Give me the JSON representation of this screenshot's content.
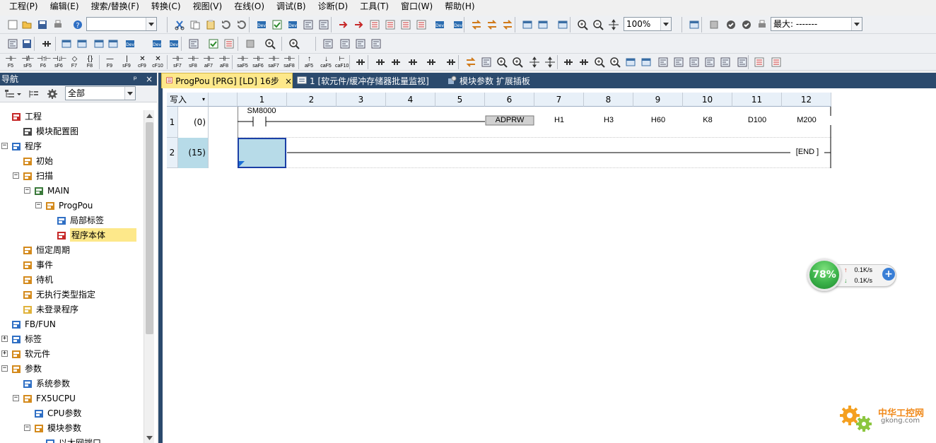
{
  "menu": [
    "工程(P)",
    "编辑(E)",
    "搜索/替换(F)",
    "转换(C)",
    "视图(V)",
    "在线(O)",
    "调试(B)",
    "诊断(D)",
    "工具(T)",
    "窗口(W)",
    "帮助(H)"
  ],
  "toolbar": {
    "zoom": "100%",
    "max_label": "最大: -------"
  },
  "function_keys": [
    {
      "sym": "⊣⊢",
      "label": "F5"
    },
    {
      "sym": "⊣/⊢",
      "label": "sF5"
    },
    {
      "sym": "⊣↑⊢",
      "label": "F6"
    },
    {
      "sym": "⊣↓⊢",
      "label": "sF6"
    },
    {
      "sym": "◇",
      "label": "F7"
    },
    {
      "sym": "{ }",
      "label": "F8"
    },
    {
      "sym": "—",
      "label": "F9"
    },
    {
      "sym": "|",
      "label": "sF9"
    },
    {
      "sym": "✕",
      "label": "cF9"
    },
    {
      "sym": "✕",
      "label": "cF10"
    },
    {
      "sym": "⊣⊢",
      "label": "sF7"
    },
    {
      "sym": "⊣⊢",
      "label": "sF8"
    },
    {
      "sym": "⊣⊢",
      "label": "aF7"
    },
    {
      "sym": "⊣⊢",
      "label": "aF8"
    },
    {
      "sym": "⊣⊢",
      "label": "saF5"
    },
    {
      "sym": "⊣⊢",
      "label": "saF6"
    },
    {
      "sym": "⊣⊢",
      "label": "saF7"
    },
    {
      "sym": "⊣⊢",
      "label": "saF8"
    },
    {
      "sym": "↑",
      "label": "aF5"
    },
    {
      "sym": "↓",
      "label": "caF5"
    },
    {
      "sym": "⊢",
      "label": "caF10"
    }
  ],
  "nav": {
    "title": "导航",
    "pin": "ᵖ",
    "close": "×",
    "filter": "全部",
    "tree": [
      {
        "label": "工程",
        "level": 0,
        "expander": "",
        "icon": "project"
      },
      {
        "label": "模块配置图",
        "level": 1,
        "expander": "",
        "icon": "module-config"
      },
      {
        "label": "程序",
        "level": 0,
        "expander": "−",
        "icon": "program"
      },
      {
        "label": "初始",
        "level": 1,
        "expander": "",
        "icon": "folder"
      },
      {
        "label": "扫描",
        "level": 1,
        "expander": "−",
        "icon": "folder"
      },
      {
        "label": "MAIN",
        "level": 2,
        "expander": "−",
        "icon": "task"
      },
      {
        "label": "ProgPou",
        "level": 3,
        "expander": "−",
        "icon": "pou"
      },
      {
        "label": "局部标签",
        "level": 4,
        "expander": "",
        "icon": "label"
      },
      {
        "label": "程序本体",
        "level": 4,
        "expander": "",
        "icon": "body",
        "selected": true
      },
      {
        "label": "恒定周期",
        "level": 1,
        "expander": "",
        "icon": "folder"
      },
      {
        "label": "事件",
        "level": 1,
        "expander": "",
        "icon": "folder"
      },
      {
        "label": "待机",
        "level": 1,
        "expander": "",
        "icon": "folder"
      },
      {
        "label": "无执行类型指定",
        "level": 1,
        "expander": "",
        "icon": "folder"
      },
      {
        "label": "未登录程序",
        "level": 1,
        "expander": "",
        "icon": "folder-yellow"
      },
      {
        "label": "FB/FUN",
        "level": 0,
        "expander": "",
        "icon": "fb"
      },
      {
        "label": "标签",
        "level": 0,
        "expander": "+",
        "icon": "label"
      },
      {
        "label": "软元件",
        "level": 0,
        "expander": "+",
        "icon": "device"
      },
      {
        "label": "参数",
        "level": 0,
        "expander": "−",
        "icon": "param"
      },
      {
        "label": "系统参数",
        "level": 1,
        "expander": "",
        "icon": "param-sys"
      },
      {
        "label": "FX5UCPU",
        "level": 1,
        "expander": "−",
        "icon": "cpu"
      },
      {
        "label": "CPU参数",
        "level": 2,
        "expander": "",
        "icon": "param-sys"
      },
      {
        "label": "模块参数",
        "level": 2,
        "expander": "−",
        "icon": "param"
      },
      {
        "label": "以太网端口",
        "level": 3,
        "expander": "",
        "icon": "param-sys"
      }
    ]
  },
  "tabs": [
    {
      "label": "ProgPou [PRG] [LD] 16步",
      "active": true,
      "close": "×"
    },
    {
      "label": "1 [软元件/缓冲存储器批量监视]",
      "active": false,
      "close": ""
    },
    {
      "label": "模块参数 扩展插板",
      "active": false,
      "close": ""
    }
  ],
  "ladder": {
    "mode": "写入",
    "columns": [
      "1",
      "2",
      "3",
      "4",
      "5",
      "6",
      "7",
      "8",
      "9",
      "10",
      "11",
      "12"
    ],
    "rung1": {
      "row": "1",
      "step": "(0)",
      "contact": "SM8000",
      "instruction": "ADPRW",
      "operands": [
        "H1",
        "H3",
        "H60",
        "K8",
        "D100",
        "M200"
      ]
    },
    "rung2": {
      "row": "2",
      "step": "(15)",
      "end": "[END ]"
    }
  },
  "netmon": {
    "percent": "78%",
    "up": "0.1K/s",
    "down": "0.1K/s"
  },
  "watermark": {
    "cn": "中华工控网",
    "url": "gkong.com"
  },
  "colors": {
    "nav_header": "#2b4a6d",
    "selected": "#fde88a",
    "cursor": "#b7dbe8",
    "header_cells": "#e8f0f8"
  }
}
